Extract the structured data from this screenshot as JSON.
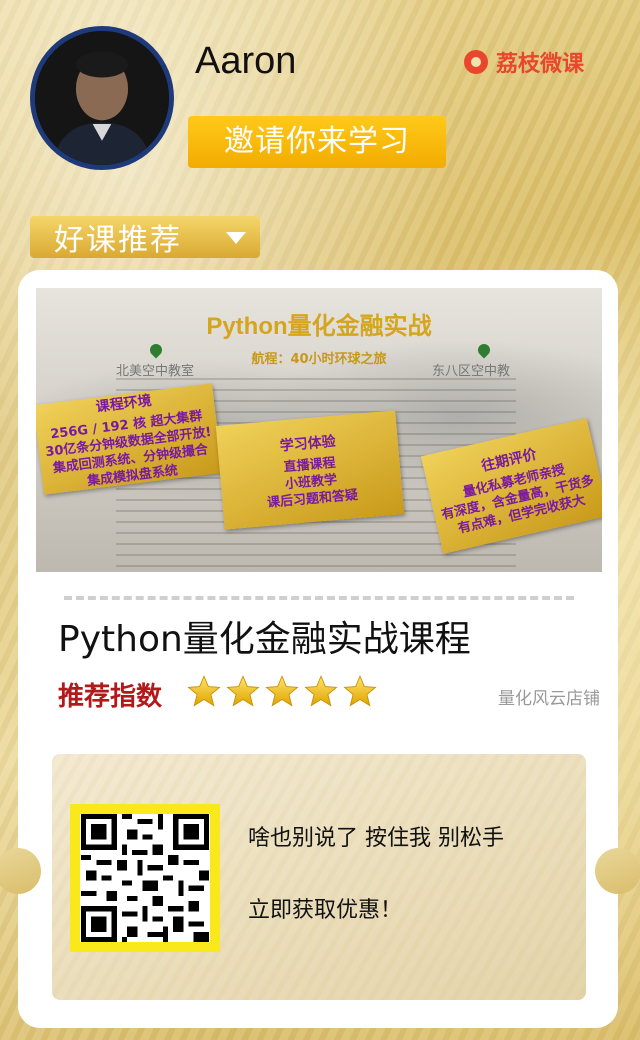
{
  "header": {
    "username": "Aaron",
    "invite_label": "邀请你来学习",
    "brand_name": "荔枝微课",
    "brand_color": "#e8472e"
  },
  "section": {
    "label": "好课推荐"
  },
  "banner": {
    "title": "Python量化金融实战",
    "subtitle": "航程：40小时环球之旅",
    "location_left": "北美空中教室",
    "location_right": "东八区空中教",
    "tickets": [
      {
        "head": "课程环境",
        "lines": [
          "256G / 192 核 超大集群",
          "30亿条分钟级数据全部开放!",
          "集成回测系统、分钟级撮合",
          "集成模拟盘系统"
        ]
      },
      {
        "head": "学习体验",
        "lines": [
          "直播课程",
          "小班教学",
          "课后习题和答疑"
        ]
      },
      {
        "head": "往期评价",
        "lines": [
          "量化私募老师亲授",
          "有深度，含金量高，干货多",
          "有点难，但学完收获大"
        ]
      }
    ]
  },
  "course": {
    "title": "Python量化金融实战课程",
    "rating_label": "推荐指数",
    "rating": 5,
    "rating_max": 5,
    "shop_name": "量化风云店铺"
  },
  "cta": {
    "line1": "啥也别说了 按住我 别松手",
    "line2": "立即获取优惠！"
  },
  "colors": {
    "accent_yellow": "#f2ac00",
    "rating_red": "#b01a1a",
    "qr_frame": "#f8e81c"
  }
}
